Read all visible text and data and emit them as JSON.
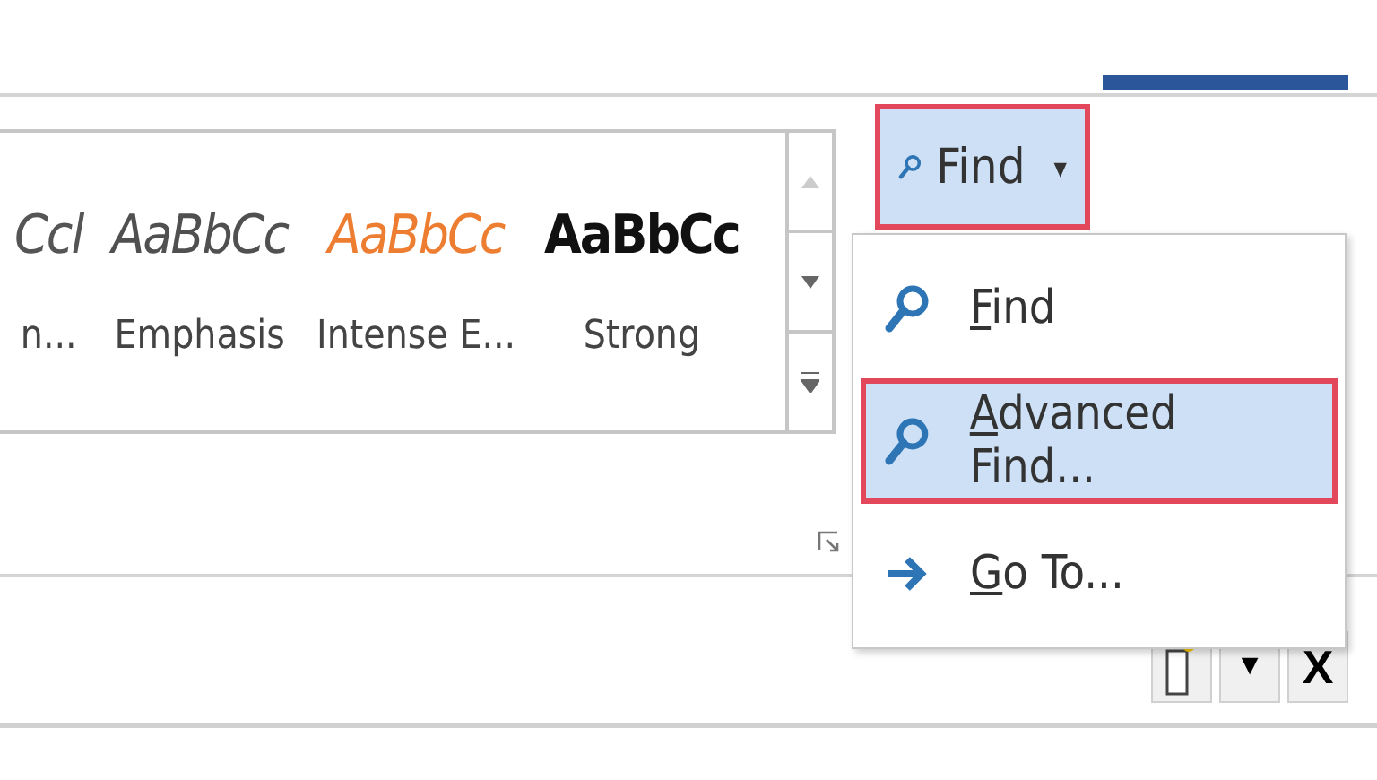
{
  "styles_gallery": {
    "items": [
      {
        "kind": "subtle",
        "preview": "Ccl",
        "label": "n..."
      },
      {
        "kind": "emphasis",
        "preview": "AaBbCc",
        "label": "Emphasis"
      },
      {
        "kind": "intense",
        "preview": "AaBbCc",
        "label": "Intense E..."
      },
      {
        "kind": "strong",
        "preview": "AaBbCc",
        "label": "Strong"
      }
    ]
  },
  "find_button": {
    "label": "Find",
    "caret": "▾",
    "highlighted": true
  },
  "find_menu": {
    "items": [
      {
        "kind": "search",
        "label": "Find",
        "selected": false,
        "highlighted": false
      },
      {
        "kind": "search",
        "label": "Advanced Find...",
        "selected": true,
        "highlighted": true
      },
      {
        "kind": "arrow",
        "label": "Go To...",
        "selected": false,
        "highlighted": false
      }
    ]
  },
  "pane_buttons": [
    {
      "kind": "new"
    },
    {
      "kind": "dropdown",
      "label": "▼"
    },
    {
      "kind": "close",
      "label": "X"
    }
  ]
}
